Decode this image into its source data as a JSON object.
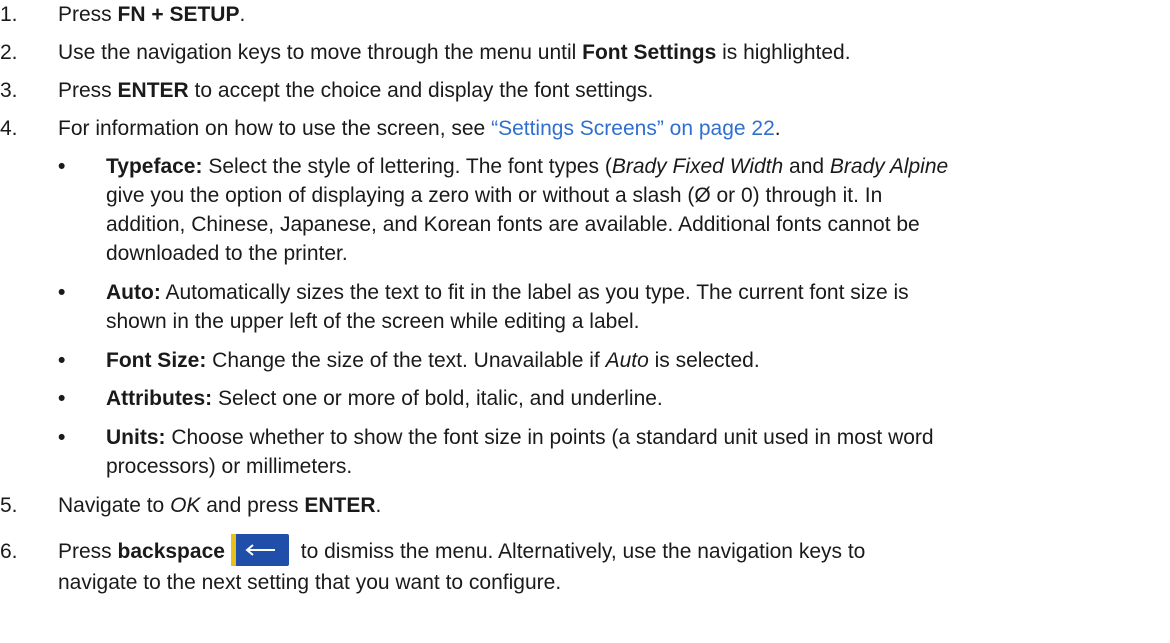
{
  "steps": [
    {
      "n": "1.",
      "parts": [
        [
          "t",
          "Press "
        ],
        [
          "b",
          "FN + SETUP"
        ],
        [
          "t",
          "."
        ]
      ]
    },
    {
      "n": "2.",
      "parts": [
        [
          "t",
          "Use the navigation keys to move through the menu until "
        ],
        [
          "b",
          "Font Settings"
        ],
        [
          "t",
          " is highlighted."
        ]
      ]
    },
    {
      "n": "3.",
      "parts": [
        [
          "t",
          "Press "
        ],
        [
          "b",
          "ENTER"
        ],
        [
          "t",
          " to accept the choice and display the font settings."
        ]
      ]
    },
    {
      "n": "4.",
      "parts": [
        [
          "t",
          "For information on how to use the screen, see "
        ],
        [
          "a",
          "“Settings Screens” on page 22"
        ],
        [
          "t",
          "."
        ]
      ]
    },
    {
      "n": "5.",
      "parts": [
        [
          "t",
          "Navigate to "
        ],
        [
          "i",
          "OK"
        ],
        [
          "t",
          " and press "
        ],
        [
          "b",
          "ENTER"
        ],
        [
          "t",
          "."
        ]
      ]
    },
    {
      "n": "6.",
      "parts": [
        [
          "t",
          "Press "
        ],
        [
          "b",
          "backspace"
        ],
        [
          "icon",
          "backspace-key-icon"
        ],
        [
          "t",
          " to dismiss the menu. Alternatively, use the navigation keys to"
        ],
        [
          "br",
          ""
        ],
        [
          "t",
          "navigate to the next setting that you want to configure."
        ]
      ]
    }
  ],
  "bullets": [
    {
      "symbol": "•",
      "parts": [
        [
          "b",
          "Typeface:"
        ],
        [
          "t",
          " Select the style of lettering. The font types ("
        ],
        [
          "i",
          "Brady Fixed Width"
        ],
        [
          "t",
          " and "
        ],
        [
          "i",
          "Brady Alpine"
        ],
        [
          "br",
          ""
        ],
        [
          "t",
          "give you the option of displaying a zero with or without a slash (Ø or 0) through it. In"
        ],
        [
          "br",
          ""
        ],
        [
          "t",
          "addition, Chinese, Japanese, and Korean fonts are available. Additional fonts cannot be"
        ],
        [
          "br",
          ""
        ],
        [
          "t",
          "downloaded to the printer."
        ]
      ]
    },
    {
      "symbol": "•",
      "parts": [
        [
          "b",
          "Auto:"
        ],
        [
          "t",
          " Automatically sizes the text to fit in the label as you type. The current font size is"
        ],
        [
          "br",
          ""
        ],
        [
          "t",
          "shown in the upper left of the screen while editing a label."
        ]
      ]
    },
    {
      "symbol": "•",
      "parts": [
        [
          "b",
          "Font Size:"
        ],
        [
          "t",
          " Change the size of the text. Unavailable if "
        ],
        [
          "i",
          "Auto"
        ],
        [
          "t",
          " is selected."
        ]
      ]
    },
    {
      "symbol": "•",
      "parts": [
        [
          "b",
          "Attributes:"
        ],
        [
          "t",
          " Select one or more of bold, italic, and underline."
        ]
      ]
    },
    {
      "symbol": "•",
      "parts": [
        [
          "b",
          "Units:"
        ],
        [
          "t",
          " Choose whether to show the font size in points (a standard unit used in most word"
        ],
        [
          "br",
          ""
        ],
        [
          "t",
          "processors) or millimeters."
        ]
      ]
    }
  ],
  "colors": {
    "link": "#2f6fd0",
    "key_bg": "#1f4fa8",
    "key_accent": "#e7c11b"
  }
}
